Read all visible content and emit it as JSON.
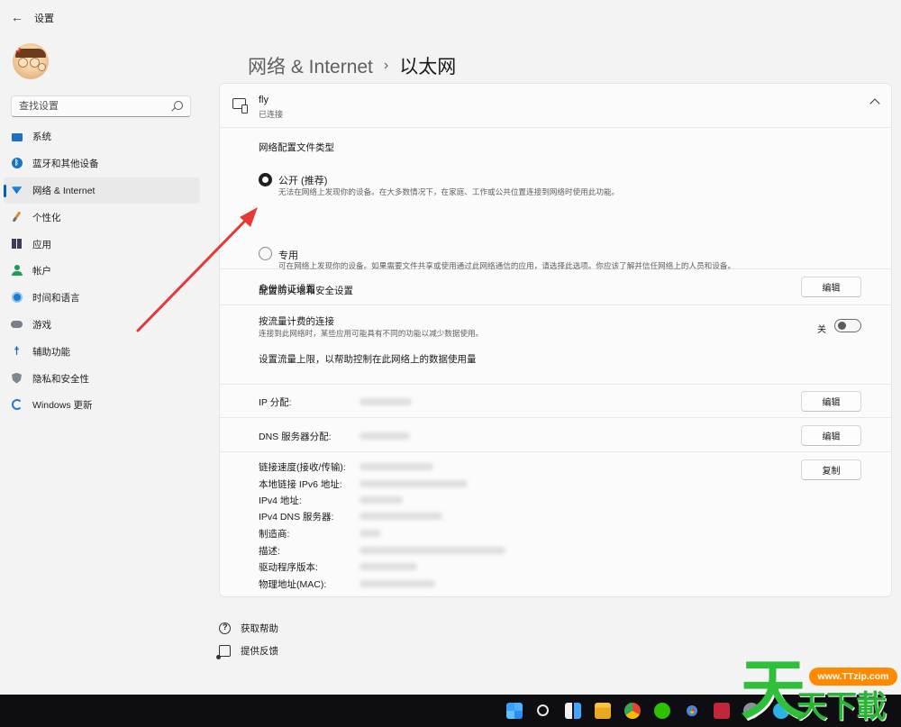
{
  "window": {
    "title": "设置",
    "back_icon": "arrow-left-icon"
  },
  "sidebar": {
    "search_placeholder": "查找设置",
    "items": [
      {
        "label": "系统",
        "icon": "monitor-icon",
        "active": false
      },
      {
        "label": "蓝牙和其他设备",
        "icon": "bluetooth-icon",
        "active": false
      },
      {
        "label": "网络 & Internet",
        "icon": "wifi-icon",
        "active": true
      },
      {
        "label": "个性化",
        "icon": "brush-icon",
        "active": false
      },
      {
        "label": "应用",
        "icon": "apps-icon",
        "active": false
      },
      {
        "label": "帐户",
        "icon": "account-icon",
        "active": false
      },
      {
        "label": "时间和语言",
        "icon": "globe-clock-icon",
        "active": false
      },
      {
        "label": "游戏",
        "icon": "gamepad-icon",
        "active": false
      },
      {
        "label": "辅助功能",
        "icon": "accessibility-icon",
        "active": false
      },
      {
        "label": "隐私和安全性",
        "icon": "shield-icon",
        "active": false
      },
      {
        "label": "Windows 更新",
        "icon": "update-icon",
        "active": false
      }
    ]
  },
  "header": {
    "parent": "网络 & Internet",
    "separator": "›",
    "current": "以太网"
  },
  "connection": {
    "name": "fly",
    "status": "已连接"
  },
  "profile": {
    "heading": "网络配置文件类型",
    "options": [
      {
        "label": "公开 (推荐)",
        "desc": "无法在网络上发现你的设备。在大多数情况下，在家庭、工作或公共位置连接到网络时使用此功能。",
        "selected": true
      },
      {
        "label": "专用",
        "desc": "可在网络上发现你的设备。如果需要文件共享或使用通过此网络通信的应用，请选择此选项。你应该了解并信任网络上的人员和设备。",
        "selected": false
      }
    ],
    "firewall_link": "配置防火墙和安全设置"
  },
  "auth": {
    "title": "身份验证设置",
    "button": "编辑"
  },
  "metered": {
    "title": "按流量计费的连接",
    "desc": "连接到此网络时，某些应用可能具有不同的功能以减少数据使用。",
    "toggle_label": "关",
    "toggle_on": false,
    "limit_link": "设置流量上限，以帮助控制在此网络上的数据使用量"
  },
  "ip": {
    "title": "IP 分配:",
    "button": "编辑"
  },
  "dns": {
    "title": "DNS 服务器分配:",
    "button": "编辑"
  },
  "properties": {
    "copy_button": "复制",
    "labels": [
      "链接速度(接收/传输):",
      "本地链接 IPv6 地址:",
      "IPv4 地址:",
      "IPv4 DNS 服务器:",
      "制造商:",
      "描述:",
      "驱动程序版本:",
      "物理地址(MAC):"
    ]
  },
  "footer": {
    "help": "获取帮助",
    "feedback": "提供反馈"
  },
  "watermark": {
    "url": "www.TTzip.com",
    "big": "天",
    "chars": "天下載"
  }
}
